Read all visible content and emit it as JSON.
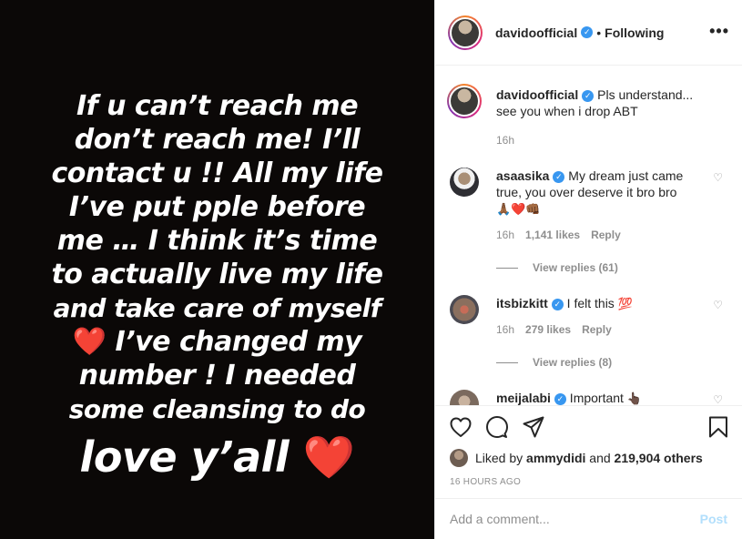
{
  "media": {
    "lines": [
      "If u can’t reach me",
      "don’t reach me! I’ll",
      "contact u !! All my life",
      "I’ve put pple before",
      "me … I think it’s time",
      "to actually live my life",
      "and take care of myself"
    ],
    "heart_line_text": " I’ve changed my",
    "line_9": "number ! I needed",
    "line_10": "some cleansing to do",
    "line_big": "love y’all ",
    "heart": "❤️"
  },
  "header": {
    "username": "davidoofficial",
    "verified_mark": "✓",
    "separator": "•",
    "follow_status": "Following",
    "more": "•••"
  },
  "caption": {
    "username": "davidoofficial",
    "text": " Pls understand... see you when i drop ABT",
    "time": "16h"
  },
  "comments": [
    {
      "username": "asaasika",
      "text": " My dream just came true, you over deserve it bro bro",
      "emoji": "🙏🏾❤️👊🏾",
      "time": "16h",
      "likes": "1,141 likes",
      "reply": "Reply",
      "view_replies": "View replies (61)"
    },
    {
      "username": "itsbizkitt",
      "text": " I felt this ",
      "emoji": "💯",
      "time": "16h",
      "likes": "279 likes",
      "reply": "Reply",
      "view_replies": "View replies (8)"
    },
    {
      "username": "meijalabi",
      "text": " Important ",
      "emoji": "👆🏿"
    }
  ],
  "actions": {
    "liked_by_prefix": "Liked by ",
    "liked_by_user": "ammydidi",
    "liked_by_mid": " and ",
    "liked_by_count": "219,904 others",
    "time_ago": "16 HOURS AGO"
  },
  "add_comment": {
    "placeholder": "Add a comment...",
    "post_label": "Post"
  },
  "colors": {
    "verified": "#3897f0",
    "muted": "#8e8e8e",
    "post_disabled": "#b2dffc",
    "heart": "#e0202a"
  }
}
